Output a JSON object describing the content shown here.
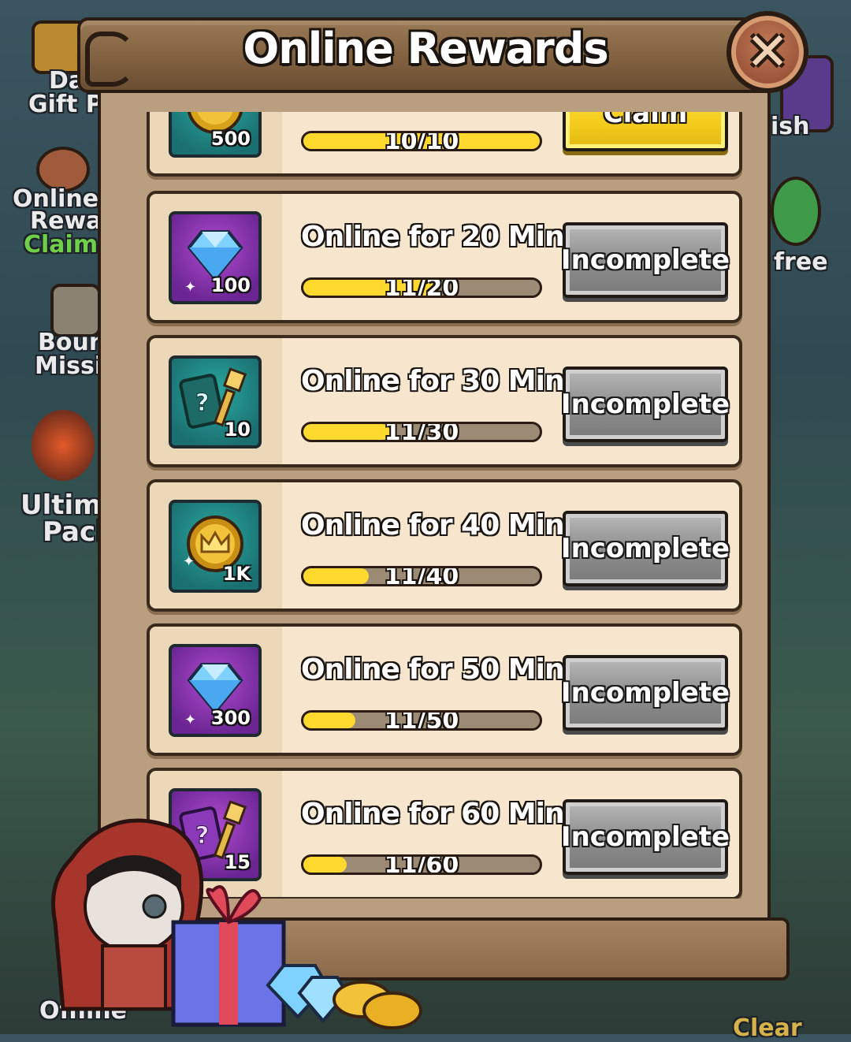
{
  "background": {
    "left_labels": [
      {
        "text": "Dai",
        "line2": "Gift Pa"
      },
      {
        "text": "Online T",
        "line2": "Rewar",
        "line3": "Claima"
      },
      {
        "text": "Boun",
        "line2": "Missio"
      },
      {
        "text": "Ultima",
        "line2": "Pacl"
      },
      {
        "text": "Offline"
      }
    ],
    "right_labels": [
      "ish",
      "free",
      "Clear"
    ]
  },
  "dialog": {
    "title": "Online Rewards",
    "close_icon": "close-icon"
  },
  "rewards": [
    {
      "title": "",
      "reward_type": "gold-crown-coin",
      "quantity": "500",
      "progress_text": "10/10",
      "progress": 1.0,
      "status": "claim",
      "button_label": "Claim"
    },
    {
      "title": "Online for 20 Min",
      "reward_type": "diamond",
      "quantity": "100",
      "progress_text": "11/20",
      "progress": 0.55,
      "status": "incomplete",
      "button_label": "Incomplete"
    },
    {
      "title": "Online for 30 Min",
      "reward_type": "mystery-card",
      "quantity": "10",
      "progress_text": "11/30",
      "progress": 0.367,
      "status": "incomplete",
      "button_label": "Incomplete"
    },
    {
      "title": "Online for 40 Min",
      "reward_type": "gold-crown-coin",
      "quantity": "1K",
      "progress_text": "11/40",
      "progress": 0.275,
      "status": "incomplete",
      "button_label": "Incomplete"
    },
    {
      "title": "Online for 50 Min",
      "reward_type": "diamond",
      "quantity": "300",
      "progress_text": "11/50",
      "progress": 0.22,
      "status": "incomplete",
      "button_label": "Incomplete"
    },
    {
      "title": "Online for 60 Min",
      "reward_type": "mystery-card-purple",
      "quantity": "15",
      "progress_text": "11/60",
      "progress": 0.183,
      "status": "incomplete",
      "button_label": "Incomplete"
    }
  ],
  "colors": {
    "progress_fill": "#ffd92e",
    "claim_button": "#f5cf1f",
    "incomplete_button": "#8f8f8f"
  }
}
